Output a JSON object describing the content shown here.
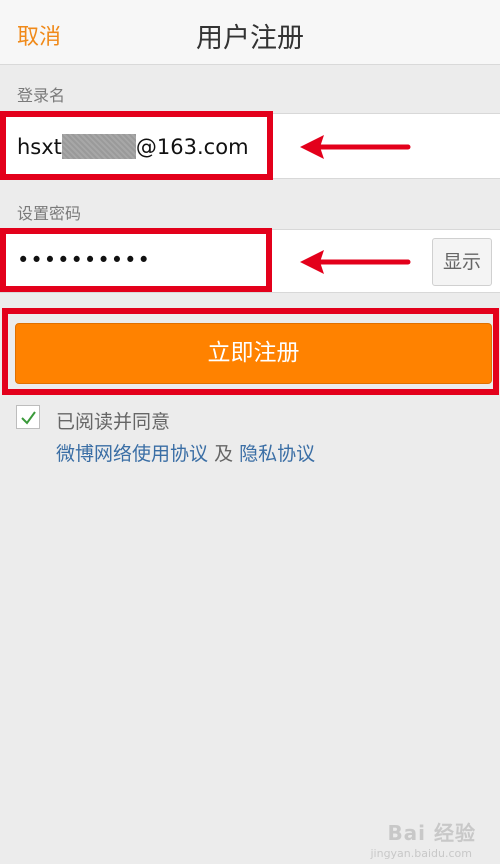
{
  "header": {
    "cancel_label": "取消",
    "title": "用户注册"
  },
  "login": {
    "label": "登录名",
    "value_prefix": "hsxt",
    "value_suffix": "@163.com"
  },
  "password": {
    "label": "设置密码",
    "value": "••••••••••",
    "show_label": "显示"
  },
  "register_button": "立即注册",
  "agreement": {
    "checked": true,
    "text": "已阅读并同意",
    "link1": "微博网络使用协议",
    "and": "及",
    "link2": "隐私协议"
  },
  "watermark": {
    "text": "Bai 经验",
    "sub": "jingyan.baidu.com"
  },
  "colors": {
    "accent": "#ff8200",
    "annotation_red": "#e3001b",
    "link": "#3a6ea5"
  }
}
